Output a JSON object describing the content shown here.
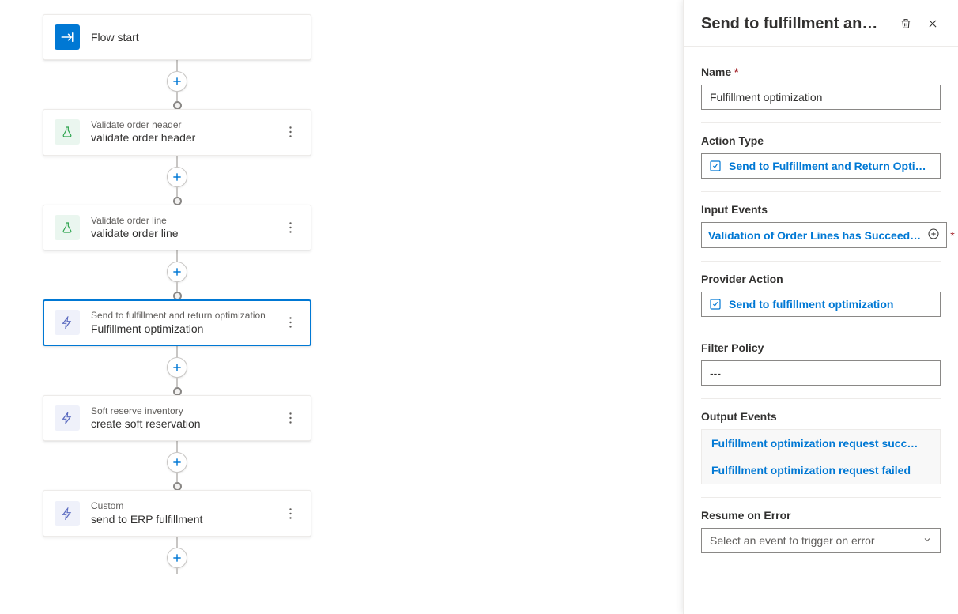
{
  "flow": {
    "start_label": "Flow start",
    "nodes": [
      {
        "type": "Validate order header",
        "name": "validate order header",
        "icon": "flask"
      },
      {
        "type": "Validate order line",
        "name": "validate order line",
        "icon": "flask"
      },
      {
        "type": "Send to fulfillment and return optimization",
        "name": "Fulfillment optimization",
        "icon": "bolt",
        "selected": true
      },
      {
        "type": "Soft reserve inventory",
        "name": "create soft reservation",
        "icon": "bolt"
      },
      {
        "type": "Custom",
        "name": "send to ERP fulfillment",
        "icon": "bolt"
      }
    ]
  },
  "panel": {
    "title": "Send to fulfillment an…",
    "name_label": "Name",
    "name_value": "Fulfillment optimization",
    "action_type_label": "Action Type",
    "action_type_value": "Send to Fulfillment and Return Optimiza…",
    "input_events_label": "Input Events",
    "input_events_value": "Validation of Order Lines has Succeed…",
    "provider_action_label": "Provider Action",
    "provider_action_value": "Send to fulfillment optimization",
    "filter_policy_label": "Filter Policy",
    "filter_policy_value": "---",
    "output_events_label": "Output Events",
    "output_events": [
      "Fulfillment optimization request succ…",
      "Fulfillment optimization request failed"
    ],
    "resume_label": "Resume on Error",
    "resume_placeholder": "Select an event to trigger on error"
  }
}
